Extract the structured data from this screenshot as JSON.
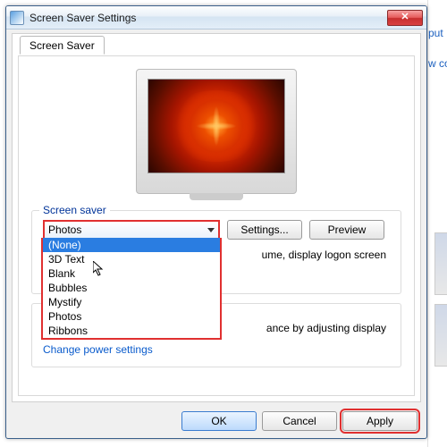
{
  "bgRight": {
    "link1": "put",
    "link2": "w col"
  },
  "window": {
    "title": "Screen Saver Settings",
    "close_glyph": "✕"
  },
  "tab": {
    "label": "Screen Saver"
  },
  "group1": {
    "title": "Screen saver",
    "combo_value": "Photos",
    "settings_btn": "Settings...",
    "preview_btn": "Preview",
    "options": {
      "o0": "(None)",
      "o1": "3D Text",
      "o2": "Blank",
      "o3": "Bubbles",
      "o4": "Mystify",
      "o5": "Photos",
      "o6": "Ribbons"
    },
    "wait_tail": "ume, display logon screen"
  },
  "group2": {
    "text_tail": "ance by adjusting display",
    "link": "Change power settings"
  },
  "buttons": {
    "ok": "OK",
    "cancel": "Cancel",
    "apply": "Apply"
  }
}
